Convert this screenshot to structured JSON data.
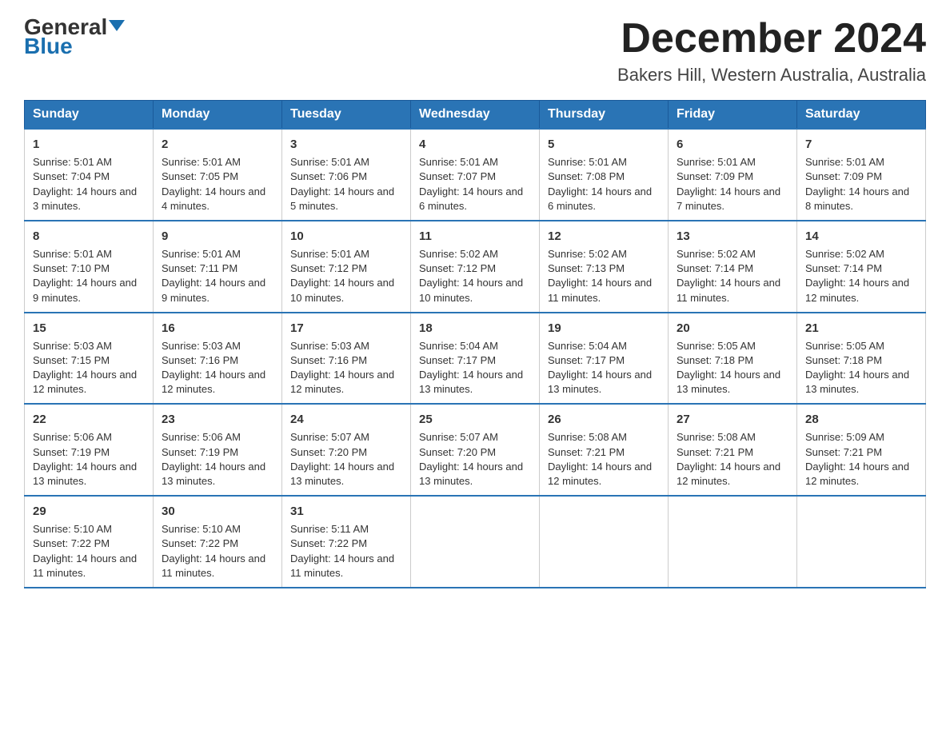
{
  "logo": {
    "line1": "General",
    "line2": "Blue",
    "arrow": "▶"
  },
  "title": {
    "month_year": "December 2024",
    "location": "Bakers Hill, Western Australia, Australia"
  },
  "days_of_week": [
    "Sunday",
    "Monday",
    "Tuesday",
    "Wednesday",
    "Thursday",
    "Friday",
    "Saturday"
  ],
  "weeks": [
    [
      {
        "day": "1",
        "sunrise": "5:01 AM",
        "sunset": "7:04 PM",
        "daylight": "14 hours and 3 minutes."
      },
      {
        "day": "2",
        "sunrise": "5:01 AM",
        "sunset": "7:05 PM",
        "daylight": "14 hours and 4 minutes."
      },
      {
        "day": "3",
        "sunrise": "5:01 AM",
        "sunset": "7:06 PM",
        "daylight": "14 hours and 5 minutes."
      },
      {
        "day": "4",
        "sunrise": "5:01 AM",
        "sunset": "7:07 PM",
        "daylight": "14 hours and 6 minutes."
      },
      {
        "day": "5",
        "sunrise": "5:01 AM",
        "sunset": "7:08 PM",
        "daylight": "14 hours and 6 minutes."
      },
      {
        "day": "6",
        "sunrise": "5:01 AM",
        "sunset": "7:09 PM",
        "daylight": "14 hours and 7 minutes."
      },
      {
        "day": "7",
        "sunrise": "5:01 AM",
        "sunset": "7:09 PM",
        "daylight": "14 hours and 8 minutes."
      }
    ],
    [
      {
        "day": "8",
        "sunrise": "5:01 AM",
        "sunset": "7:10 PM",
        "daylight": "14 hours and 9 minutes."
      },
      {
        "day": "9",
        "sunrise": "5:01 AM",
        "sunset": "7:11 PM",
        "daylight": "14 hours and 9 minutes."
      },
      {
        "day": "10",
        "sunrise": "5:01 AM",
        "sunset": "7:12 PM",
        "daylight": "14 hours and 10 minutes."
      },
      {
        "day": "11",
        "sunrise": "5:02 AM",
        "sunset": "7:12 PM",
        "daylight": "14 hours and 10 minutes."
      },
      {
        "day": "12",
        "sunrise": "5:02 AM",
        "sunset": "7:13 PM",
        "daylight": "14 hours and 11 minutes."
      },
      {
        "day": "13",
        "sunrise": "5:02 AM",
        "sunset": "7:14 PM",
        "daylight": "14 hours and 11 minutes."
      },
      {
        "day": "14",
        "sunrise": "5:02 AM",
        "sunset": "7:14 PM",
        "daylight": "14 hours and 12 minutes."
      }
    ],
    [
      {
        "day": "15",
        "sunrise": "5:03 AM",
        "sunset": "7:15 PM",
        "daylight": "14 hours and 12 minutes."
      },
      {
        "day": "16",
        "sunrise": "5:03 AM",
        "sunset": "7:16 PM",
        "daylight": "14 hours and 12 minutes."
      },
      {
        "day": "17",
        "sunrise": "5:03 AM",
        "sunset": "7:16 PM",
        "daylight": "14 hours and 12 minutes."
      },
      {
        "day": "18",
        "sunrise": "5:04 AM",
        "sunset": "7:17 PM",
        "daylight": "14 hours and 13 minutes."
      },
      {
        "day": "19",
        "sunrise": "5:04 AM",
        "sunset": "7:17 PM",
        "daylight": "14 hours and 13 minutes."
      },
      {
        "day": "20",
        "sunrise": "5:05 AM",
        "sunset": "7:18 PM",
        "daylight": "14 hours and 13 minutes."
      },
      {
        "day": "21",
        "sunrise": "5:05 AM",
        "sunset": "7:18 PM",
        "daylight": "14 hours and 13 minutes."
      }
    ],
    [
      {
        "day": "22",
        "sunrise": "5:06 AM",
        "sunset": "7:19 PM",
        "daylight": "14 hours and 13 minutes."
      },
      {
        "day": "23",
        "sunrise": "5:06 AM",
        "sunset": "7:19 PM",
        "daylight": "14 hours and 13 minutes."
      },
      {
        "day": "24",
        "sunrise": "5:07 AM",
        "sunset": "7:20 PM",
        "daylight": "14 hours and 13 minutes."
      },
      {
        "day": "25",
        "sunrise": "5:07 AM",
        "sunset": "7:20 PM",
        "daylight": "14 hours and 13 minutes."
      },
      {
        "day": "26",
        "sunrise": "5:08 AM",
        "sunset": "7:21 PM",
        "daylight": "14 hours and 12 minutes."
      },
      {
        "day": "27",
        "sunrise": "5:08 AM",
        "sunset": "7:21 PM",
        "daylight": "14 hours and 12 minutes."
      },
      {
        "day": "28",
        "sunrise": "5:09 AM",
        "sunset": "7:21 PM",
        "daylight": "14 hours and 12 minutes."
      }
    ],
    [
      {
        "day": "29",
        "sunrise": "5:10 AM",
        "sunset": "7:22 PM",
        "daylight": "14 hours and 11 minutes."
      },
      {
        "day": "30",
        "sunrise": "5:10 AM",
        "sunset": "7:22 PM",
        "daylight": "14 hours and 11 minutes."
      },
      {
        "day": "31",
        "sunrise": "5:11 AM",
        "sunset": "7:22 PM",
        "daylight": "14 hours and 11 minutes."
      },
      null,
      null,
      null,
      null
    ]
  ]
}
